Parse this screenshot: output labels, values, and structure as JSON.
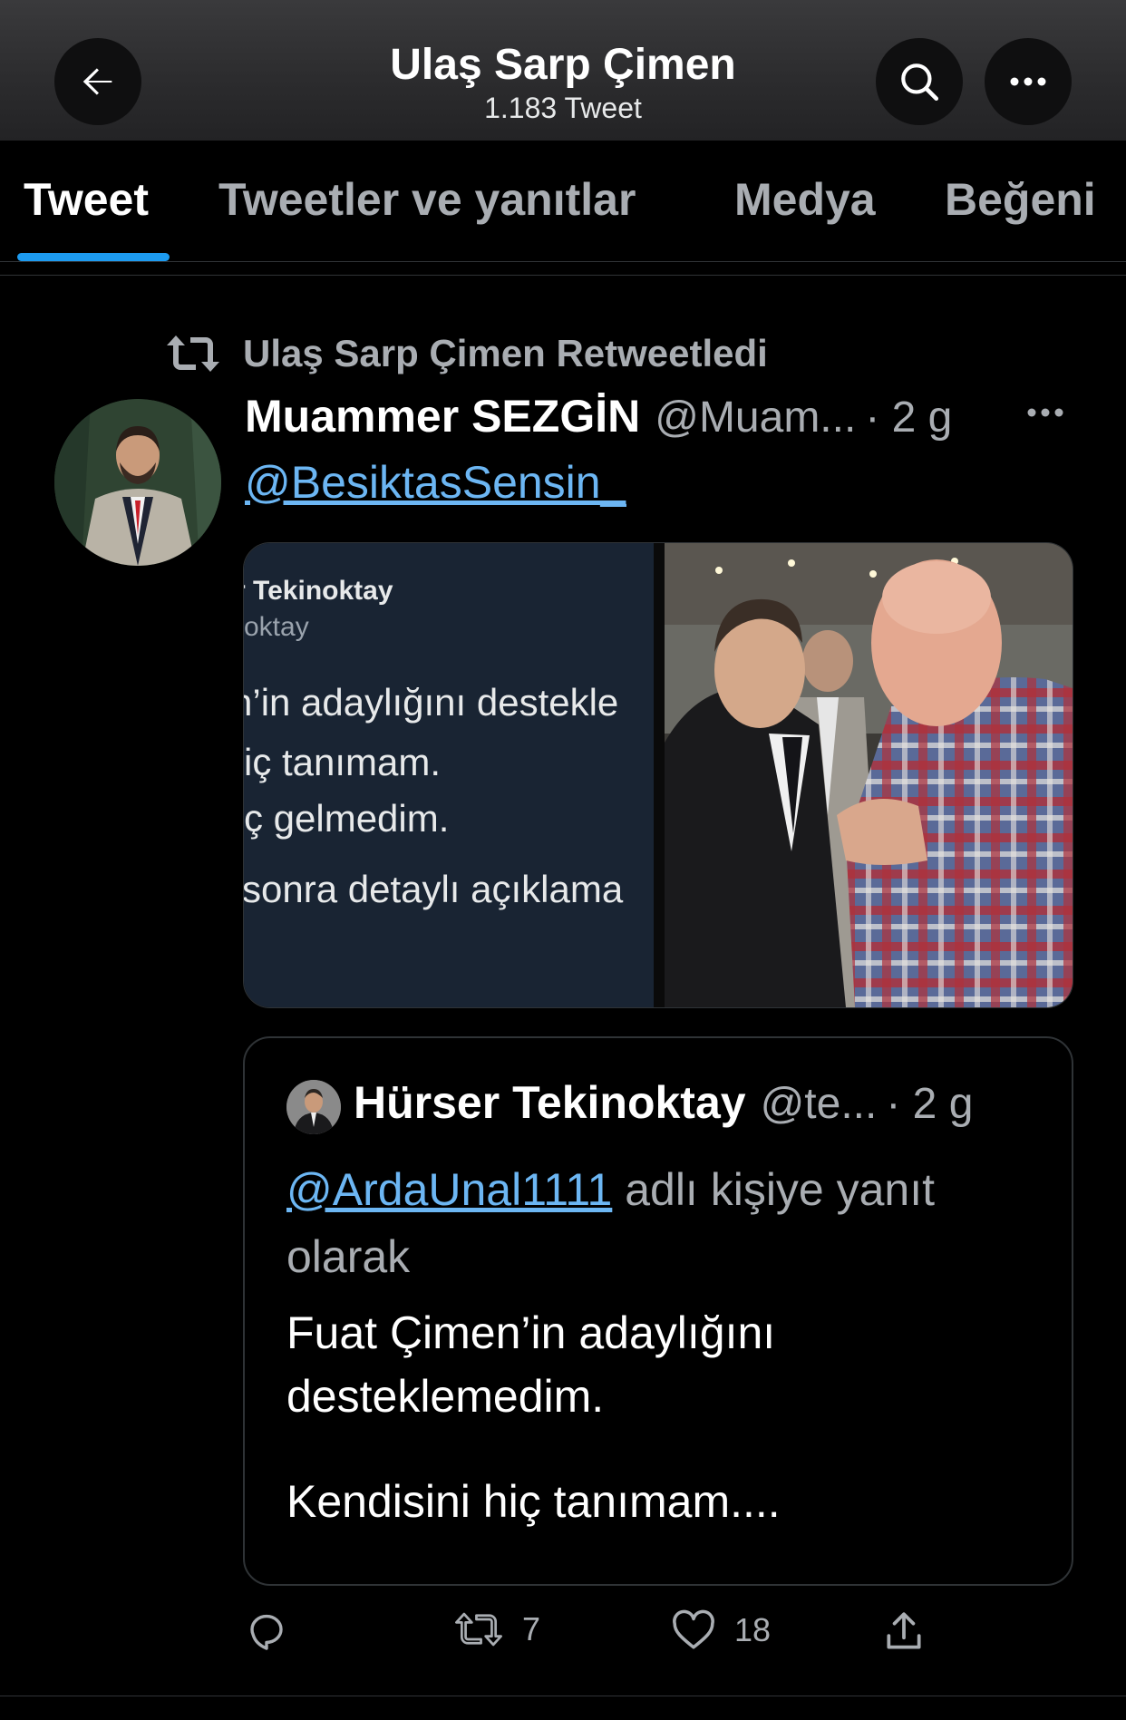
{
  "header": {
    "title": "Ulaş Sarp Çimen",
    "tweet_count": "1.183 Tweet"
  },
  "tabs": [
    {
      "label": "Tweet",
      "active": true
    },
    {
      "label": "Tweetler ve yanıtlar",
      "active": false
    },
    {
      "label": "Medya",
      "active": false
    },
    {
      "label": "Beğeni",
      "active": false
    }
  ],
  "tweet": {
    "retweet_context": "Ulaş Sarp Çimen Retweetledi",
    "author_name": "Muammer SEZGİN",
    "author_handle": "@Muam...",
    "time": "· 2 g",
    "text_mention": "@BesiktasSensin_",
    "media_left_lines": [
      "r Tekinoktay",
      "oktay",
      "n’in adaylığını destekle",
      "iç tanımam.",
      "ç gelmedim.",
      "sonra detaylı açıklama"
    ],
    "quote": {
      "author_name": "Hürser Tekinoktay",
      "author_handle": "@te...",
      "time": "· 2 g",
      "reply_mention": "@ArdaUnal1111",
      "reply_suffix": " adlı kişiye yanıt olarak",
      "body_line1": "Fuat Çimen’in adaylığını",
      "body_line2": "desteklemedim.",
      "body_line3": "Kendisini hiç tanımam...."
    },
    "actions": {
      "retweets": "7",
      "likes": "18"
    }
  },
  "colors": {
    "background": "#000000",
    "accent": "#1d9bf0",
    "link": "#6cb6f3",
    "muted": "#a9adb2"
  }
}
